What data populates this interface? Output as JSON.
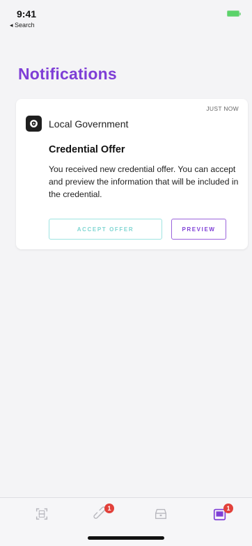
{
  "status_bar": {
    "time": "9:41",
    "back_label": "◂ Search"
  },
  "header": {
    "title": "Notifications"
  },
  "notification": {
    "time": "JUST NOW",
    "org_name": "Local Government",
    "heading": "Credential Offer",
    "body": "You received new credential offer. You can accept and preview the information that will be included in the credential.",
    "accept_label": "ACCEPT OFFER",
    "preview_label": "PREVIEW"
  },
  "tabbar": {
    "items": [
      {
        "icon": "scan-icon",
        "badge": ""
      },
      {
        "icon": "connections-icon",
        "badge": "1"
      },
      {
        "icon": "wallet-icon",
        "badge": ""
      },
      {
        "icon": "notifications-icon",
        "badge": "1"
      }
    ]
  },
  "colors": {
    "accent": "#7e3ed6",
    "accept_border": "#9ee4e1",
    "badge": "#e2413b"
  }
}
